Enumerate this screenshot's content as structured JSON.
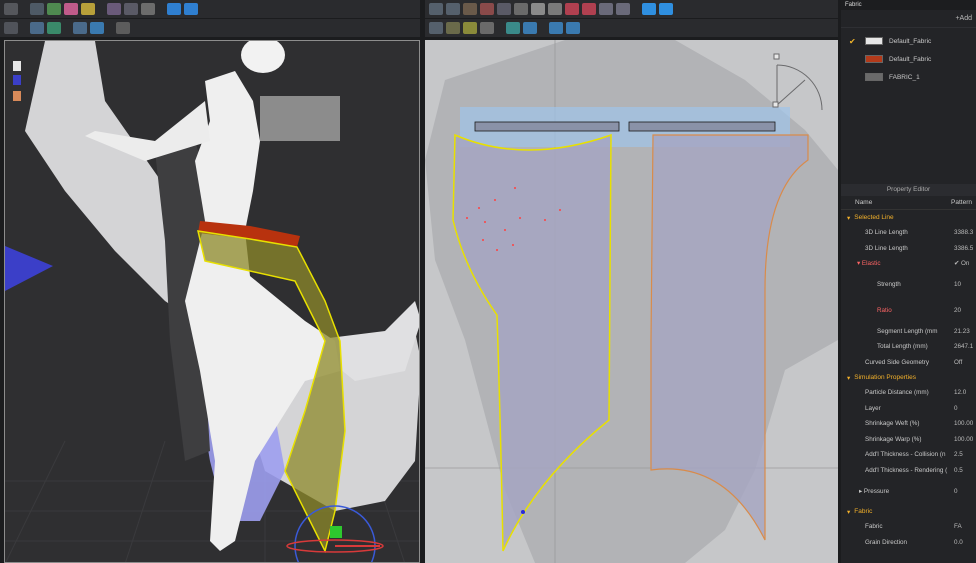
{
  "fabric_list": {
    "tab_label": "Fabric",
    "add_label": "+Add",
    "items": [
      {
        "name": "Default_Fabric",
        "checked": true,
        "color": "#e6e6e6"
      },
      {
        "name": "Default_Fabric",
        "checked": false,
        "color": "#b33a1a"
      },
      {
        "name": "FABRIC_1",
        "checked": false,
        "color": "#6a6a6a"
      }
    ]
  },
  "property_editor": {
    "title": "Property Editor",
    "col_name": "Name",
    "col_value": "Pattern",
    "selected_line": {
      "label": "Selected Line",
      "line_length_1_label": "3D Line Length",
      "line_length_1_value": "3388.3",
      "line_length_2_label": "3D Line Length",
      "line_length_2_value": "3386.5",
      "elastic_label": "Elastic",
      "elastic_value": "On",
      "strength_label": "Strength",
      "strength_value": "10",
      "ratio_label": "Ratio",
      "ratio_value": "20",
      "segment_label": "Segment Length (mm",
      "segment_value": "21.23",
      "total_label": "Total Length (mm)",
      "total_value": "2647.1",
      "curved_label": "Curved Side Geometry",
      "curved_value": "Off"
    },
    "simulation": {
      "label": "Simulation Properties",
      "rows": [
        {
          "label": "Particle Distance (mm)",
          "value": "12.0"
        },
        {
          "label": "Layer",
          "value": "0"
        },
        {
          "label": "Shrinkage Weft (%)",
          "value": "100.00"
        },
        {
          "label": "Shrinkage Warp (%)",
          "value": "100.00"
        },
        {
          "label": "Add'l Thickness - Collision (n",
          "value": "2.5"
        },
        {
          "label": "Add'l Thickness - Rendering (",
          "value": "0.5"
        }
      ],
      "pressure_label": "Pressure",
      "pressure_value": "0"
    },
    "fabric_section": {
      "label": "Fabric",
      "fabric_label": "Fabric",
      "fabric_value": "FA",
      "grain_label": "Grain Direction",
      "grain_value": "0.0"
    }
  },
  "colors": {
    "accent_yellow": "#f2b52a",
    "selection_yellow": "#e8e000",
    "pattern_fill": "#a9a8c4",
    "pattern_orange": "#d98b4a",
    "elastic_red": "#ff6565"
  }
}
